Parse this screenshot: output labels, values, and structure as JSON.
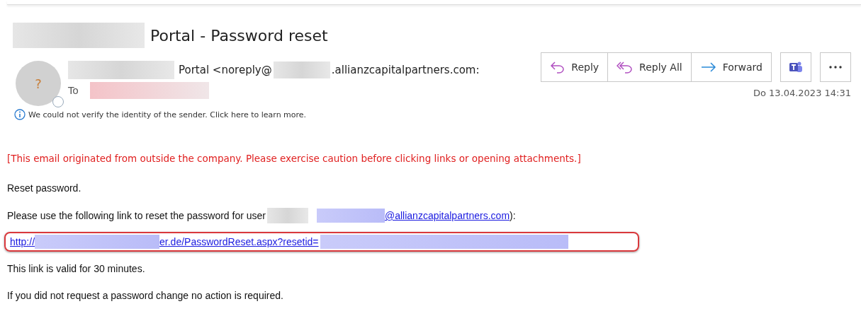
{
  "subject": {
    "visible": "Portal - Password reset"
  },
  "sender": {
    "name_visible": "Portal <noreply@",
    "domain_visible": ".allianzcapitalpartners.com:",
    "avatar": "?",
    "to_label": "To"
  },
  "actions": [
    {
      "label": "Reply",
      "kind": "reply"
    },
    {
      "label": "Reply All",
      "kind": "reply-all"
    },
    {
      "label": "Forward",
      "kind": "forward"
    }
  ],
  "date": "Do 13.04.2023 14:31",
  "notice": "We could not verify the identity of the sender. Click here to learn more.",
  "body": {
    "banner": "[This email originated from outside the company. Please exercise caution before clicking links or opening attachments.]",
    "greeting": "Reset password.",
    "instruction": "Please use the following link to reset the password for user",
    "user_email_visible": "@allianzcapitalpartners.com",
    "instruction_end": "):",
    "link_start": "http://",
    "link_middle": "er.de/PasswordReset.aspx?resetid=",
    "validity": "This link is valid for 30 minutes.",
    "closing": "If you did not request a password change no action is required."
  }
}
